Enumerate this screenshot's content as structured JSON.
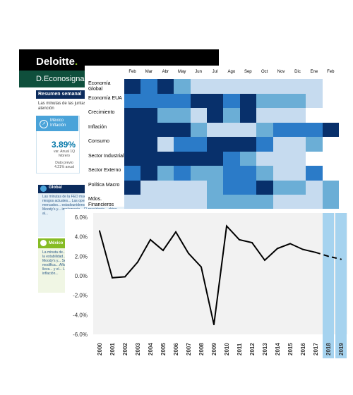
{
  "newsletter": {
    "brand": "Deloitte",
    "brand_dot": ".",
    "subtitle": "D.Econosignal",
    "summary_title": "Resumen semanal",
    "summary_text": "Las minutas de las juntas acaparon la atención",
    "inflation": {
      "label": "México Inflación",
      "value": "3.89%",
      "sub1": "var. Anual 1Q febrero",
      "sub2": "Dato previo 4.21% anual"
    },
    "global_label": "Global",
    "global_text": "Las minutas de la FED muestran... para los riesgos actuales... Las operaciones de los mercados... estadounidenses e incluso... Moody's y... implementa... El presidente... chino, al...",
    "mexico_label": "México",
    "mexico_text": "La minuta de... para la estabilidad... Moody's y... Se modifica... Aflores lleva... y el... La inflación..."
  },
  "heatmap": {
    "months": [
      "Feb",
      "Mar",
      "Abr",
      "May",
      "Jun",
      "Jul",
      "Ago",
      "Sep",
      "Oct",
      "Nov",
      "Dic",
      "Ene",
      "Feb"
    ],
    "rows": [
      "Economía Global",
      "Economía EUA",
      "Crecimiento",
      "Inflación",
      "Consumo",
      "Sector Industrial",
      "Sector Externo",
      "Política Macro",
      "Mdos. Financieros"
    ],
    "palette": [
      "#c6dbef",
      "#6baed6",
      "#2b7bc8",
      "#08306b"
    ],
    "values": [
      [
        3,
        2,
        3,
        1,
        0,
        0,
        0,
        0,
        0,
        0,
        0,
        0,
        null
      ],
      [
        2,
        2,
        2,
        2,
        3,
        3,
        2,
        3,
        1,
        1,
        1,
        0,
        null
      ],
      [
        3,
        3,
        1,
        1,
        0,
        3,
        1,
        3,
        0,
        0,
        0,
        null,
        null
      ],
      [
        3,
        3,
        3,
        3,
        1,
        0,
        0,
        0,
        1,
        2,
        2,
        2,
        3
      ],
      [
        3,
        3,
        0,
        2,
        2,
        3,
        3,
        3,
        2,
        0,
        0,
        1,
        null
      ],
      [
        3,
        3,
        3,
        3,
        3,
        3,
        2,
        1,
        0,
        0,
        0,
        null,
        null
      ],
      [
        2,
        3,
        1,
        2,
        1,
        1,
        2,
        2,
        1,
        0,
        0,
        2,
        null
      ],
      [
        3,
        0,
        0,
        0,
        0,
        1,
        2,
        2,
        3,
        1,
        1,
        0,
        1
      ],
      [
        0,
        0,
        0,
        0,
        0,
        1,
        1,
        1,
        1,
        0,
        0,
        0,
        1
      ]
    ]
  },
  "chart_data": {
    "type": "line",
    "x": [
      "2000",
      "2001",
      "2002",
      "2003",
      "2004",
      "2005",
      "2006",
      "2007",
      "2008",
      "2009",
      "2010",
      "2011",
      "2012",
      "2013",
      "2014",
      "2015",
      "2016",
      "2017",
      "2018",
      "2019"
    ],
    "values": [
      4.6,
      -0.2,
      -0.1,
      1.4,
      3.7,
      2.6,
      4.5,
      2.3,
      0.9,
      -5.0,
      5.1,
      3.7,
      3.4,
      1.6,
      2.8,
      3.3,
      2.7,
      2.4,
      2.0,
      1.7
    ],
    "forecast_from": "2017",
    "highlight": [
      "2018",
      "2019"
    ],
    "yticks": [
      "6.0%",
      "4.0%",
      "2.0%",
      "0.0%",
      "-2.0%",
      "-4.0%",
      "-6.0%"
    ],
    "ylim": [
      -6,
      6
    ],
    "grid": false,
    "colors": {
      "line": "#000000",
      "plot_bg": "#f2f2f2",
      "highlight": "#a6d3ef"
    }
  }
}
